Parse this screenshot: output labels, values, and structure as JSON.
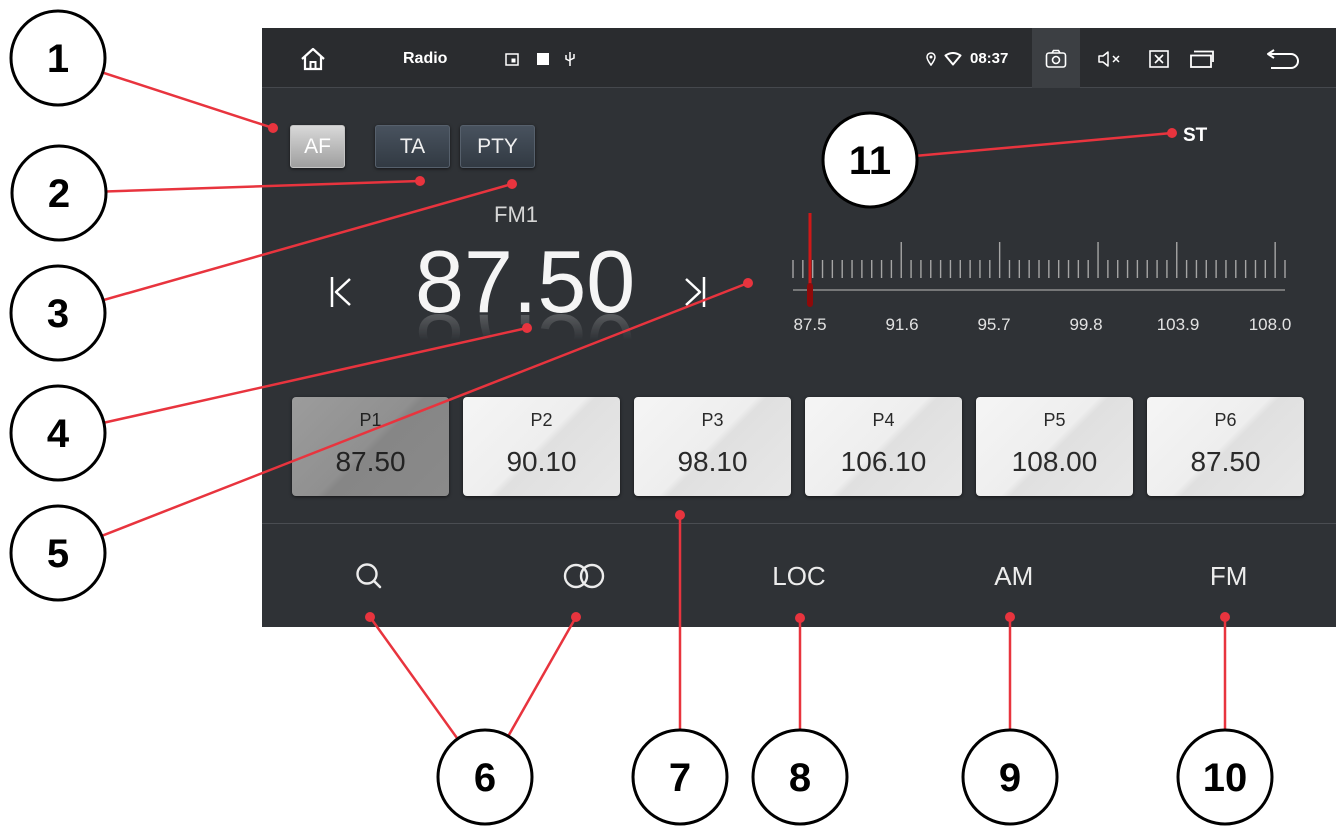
{
  "status_bar": {
    "app_title": "Radio",
    "time": "08:37",
    "left_icons": [
      "home-icon"
    ],
    "indicator_icons": [
      "window-icon",
      "square-icon",
      "usb-icon"
    ],
    "right_icons": [
      "location-icon",
      "wifi-icon",
      "screenshot-icon",
      "mute-icon",
      "close-app-icon",
      "recent-apps-icon",
      "back-icon"
    ]
  },
  "rds_buttons": [
    {
      "label": "AF",
      "active": true
    },
    {
      "label": "TA",
      "active": false
    },
    {
      "label": "PTY",
      "active": false
    }
  ],
  "band": "FM1",
  "frequency": "87.50",
  "seek_controls": {
    "prev_icon": "seek-previous-icon",
    "next_icon": "seek-next-icon"
  },
  "stereo_indicator": "ST",
  "tuner_scale": {
    "min": 87.5,
    "max": 108.0,
    "current": 87.5,
    "labels": [
      "87.5",
      "91.6",
      "95.7",
      "99.8",
      "103.9",
      "108.0"
    ]
  },
  "presets": [
    {
      "label": "P1",
      "frequency": "87.50",
      "selected": true
    },
    {
      "label": "P2",
      "frequency": "90.10",
      "selected": false
    },
    {
      "label": "P3",
      "frequency": "98.10",
      "selected": false
    },
    {
      "label": "P4",
      "frequency": "106.10",
      "selected": false
    },
    {
      "label": "P5",
      "frequency": "108.00",
      "selected": false
    },
    {
      "label": "P6",
      "frequency": "87.50",
      "selected": false
    }
  ],
  "bottom_bar": {
    "search_icon": "search-icon",
    "stereo_icon": "stereo-icon",
    "loc_label": "LOC",
    "am_label": "AM",
    "fm_label": "FM"
  },
  "callouts": [
    "1",
    "2",
    "3",
    "4",
    "5",
    "6",
    "7",
    "8",
    "9",
    "10",
    "11"
  ],
  "colors": {
    "screen_background": "#2f3236",
    "status_bar_background": "#2a2c2f",
    "needle": "#d01818",
    "needle_knob": "#8e0a0a",
    "callout_line": "#e8343e"
  }
}
